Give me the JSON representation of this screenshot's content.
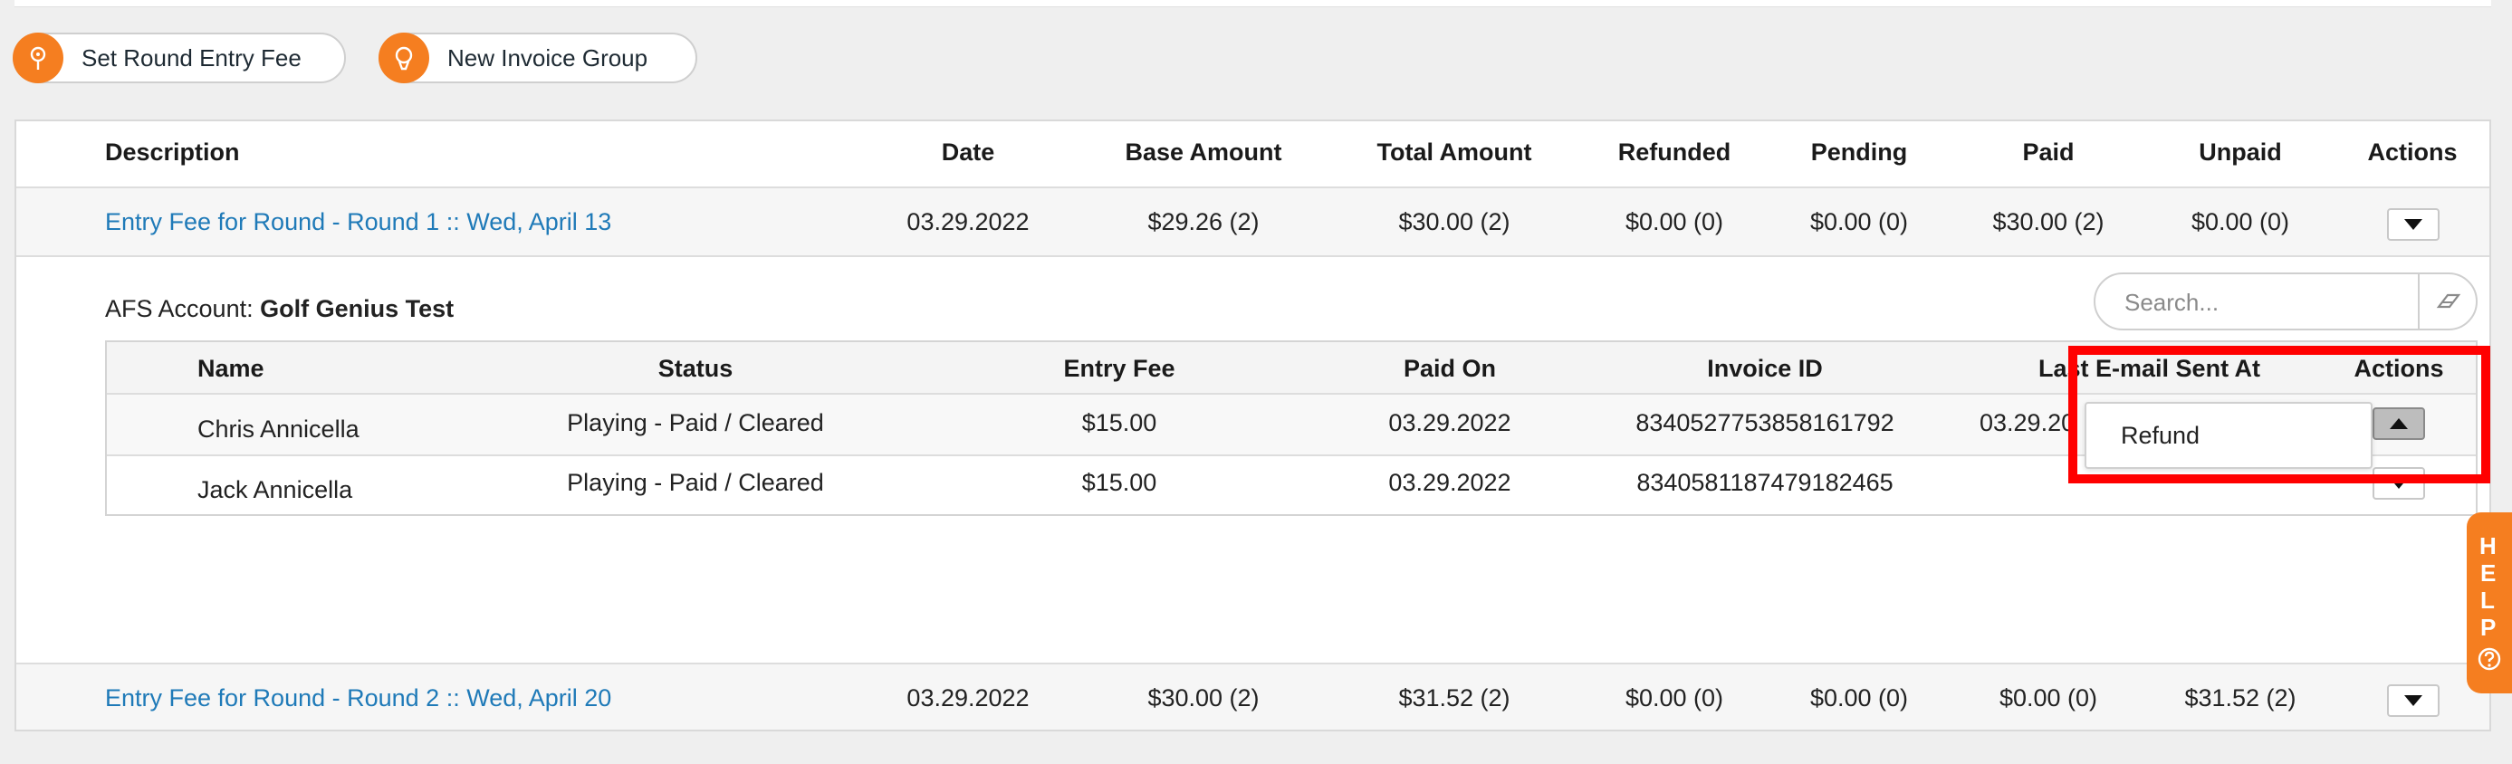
{
  "toolbar": {
    "set_round_entry_fee": "Set Round Entry Fee",
    "new_invoice_group": "New Invoice Group"
  },
  "table": {
    "headers": [
      "Description",
      "Date",
      "Base Amount",
      "Total Amount",
      "Refunded",
      "Pending",
      "Paid",
      "Unpaid",
      "Actions"
    ],
    "rows": [
      {
        "description": "Entry Fee for Round - Round 1 :: Wed, April 13",
        "date": "03.29.2022",
        "base_amount": "$29.26 (2)",
        "total_amount": "$30.00 (2)",
        "refunded": "$0.00 (0)",
        "pending": "$0.00 (0)",
        "paid": "$30.00 (2)",
        "unpaid": "$0.00 (0)"
      },
      {
        "description": "Entry Fee for Round - Round 2 :: Wed, April 20",
        "date": "03.29.2022",
        "base_amount": "$30.00 (2)",
        "total_amount": "$31.52 (2)",
        "refunded": "$0.00 (0)",
        "pending": "$0.00 (0)",
        "paid": "$0.00 (0)",
        "unpaid": "$31.52 (2)"
      }
    ]
  },
  "details": {
    "account_label": "AFS Account:",
    "account_name": "Golf Genius Test",
    "search_placeholder": "Search...",
    "headers": [
      "Name",
      "Status",
      "Entry Fee",
      "Paid On",
      "Invoice ID",
      "Last E-mail Sent At",
      "Actions"
    ],
    "rows": [
      {
        "name": "Chris Annicella",
        "status": "Playing - Paid / Cleared",
        "entry_fee": "$15.00",
        "paid_on": "03.29.2022",
        "invoice_id": "8340527753858161792",
        "last_email": "03.29.20"
      },
      {
        "name": "Jack Annicella",
        "status": "Playing - Paid / Cleared",
        "entry_fee": "$15.00",
        "paid_on": "03.29.2022",
        "invoice_id": "8340581187479182465",
        "last_email": ""
      }
    ],
    "action_menu": {
      "refund": "Refund"
    }
  },
  "help_tab": {
    "letters": [
      "H",
      "E",
      "L",
      "P"
    ]
  },
  "colors": {
    "accent": "#f57e20",
    "link": "#1f7ab8",
    "highlight": "#ff0000"
  }
}
